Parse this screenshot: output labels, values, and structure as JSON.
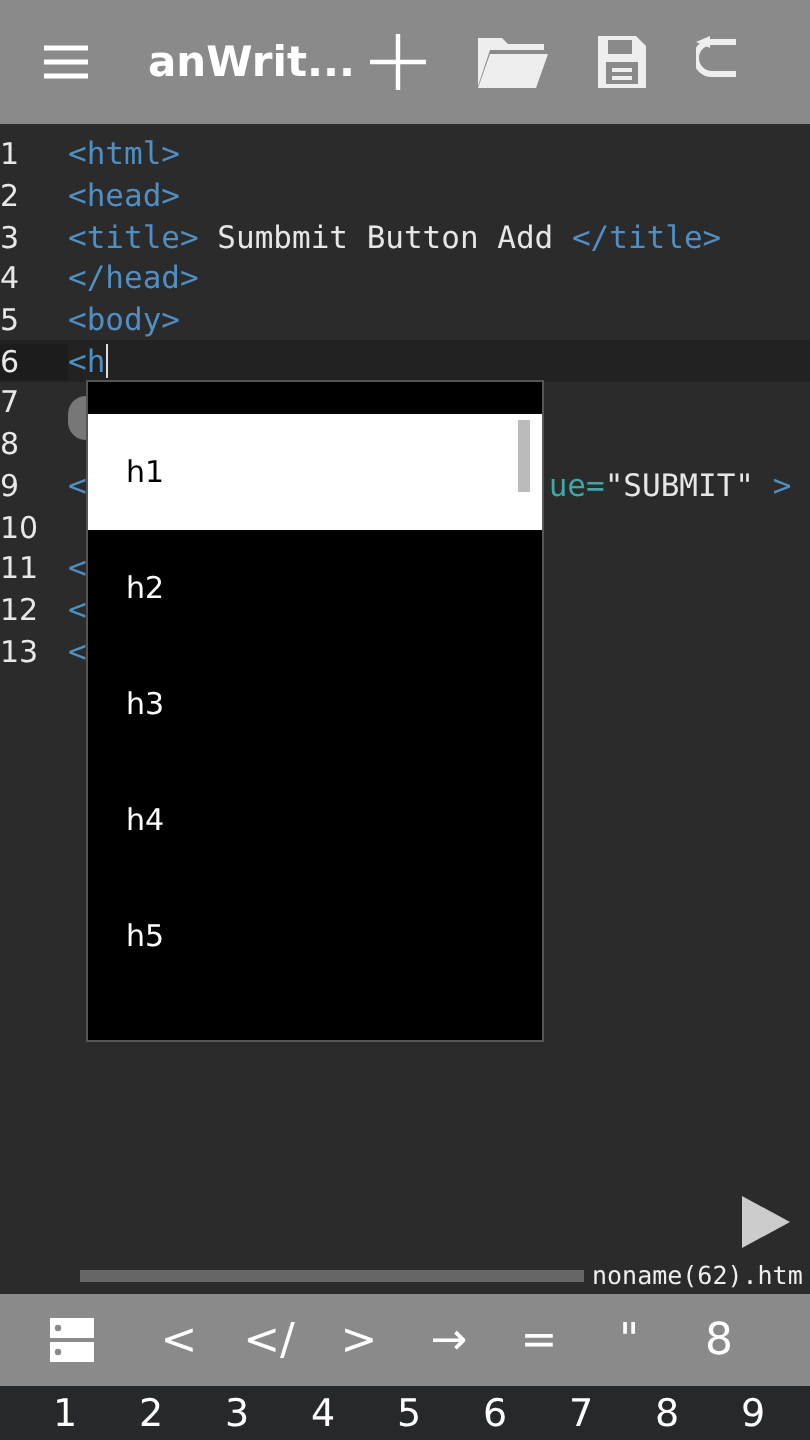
{
  "app_bar": {
    "title": "anWrit..."
  },
  "editor": {
    "lines": [
      {
        "number": "1",
        "current": false,
        "segments": [
          {
            "kind": "tag",
            "text": "<html>"
          }
        ]
      },
      {
        "number": "2",
        "current": false,
        "segments": [
          {
            "kind": "tag",
            "text": "<head>"
          }
        ]
      },
      {
        "number": "3",
        "current": false,
        "segments": [
          {
            "kind": "tag",
            "text": "<title>"
          },
          {
            "kind": "text",
            "text": " Sumbmit Button Add "
          },
          {
            "kind": "tag",
            "text": "</title>"
          }
        ]
      },
      {
        "number": "4",
        "current": false,
        "segments": [
          {
            "kind": "tag",
            "text": "</head>"
          }
        ]
      },
      {
        "number": "5",
        "current": false,
        "segments": [
          {
            "kind": "tag",
            "text": "<body>"
          }
        ]
      },
      {
        "number": "6",
        "current": true,
        "segments": [
          {
            "kind": "tag",
            "text": "<h"
          }
        ]
      },
      {
        "number": "7",
        "current": false
      },
      {
        "number": "8",
        "current": false
      },
      {
        "number": "9",
        "current": false,
        "segments": [
          {
            "kind": "tag",
            "text": "<"
          }
        ],
        "tail": [
          {
            "kind": "attr",
            "text": "ue="
          },
          {
            "kind": "text",
            "text": "\"SUBMIT\""
          },
          {
            "kind": "tag",
            "text": " >"
          }
        ]
      },
      {
        "number": "10",
        "current": false
      },
      {
        "number": "11",
        "current": false,
        "segments": [
          {
            "kind": "tag",
            "text": "<"
          }
        ]
      },
      {
        "number": "12",
        "current": false,
        "segments": [
          {
            "kind": "tag",
            "text": "<"
          }
        ]
      },
      {
        "number": "13",
        "current": false,
        "segments": [
          {
            "kind": "tag",
            "text": "<"
          }
        ]
      }
    ],
    "filename": "noname(62).htm"
  },
  "autocomplete": [
    {
      "label": "h1",
      "selected": true
    },
    {
      "label": "h2",
      "selected": false
    },
    {
      "label": "h3",
      "selected": false
    },
    {
      "label": "h4",
      "selected": false
    },
    {
      "label": "h5",
      "selected": false
    }
  ],
  "symbol_keys": [
    "<",
    "</",
    ">",
    "→",
    "=",
    "\"",
    "8"
  ],
  "number_keys": [
    "1",
    "2",
    "3",
    "4",
    "5",
    "6",
    "7",
    "8",
    "9"
  ]
}
